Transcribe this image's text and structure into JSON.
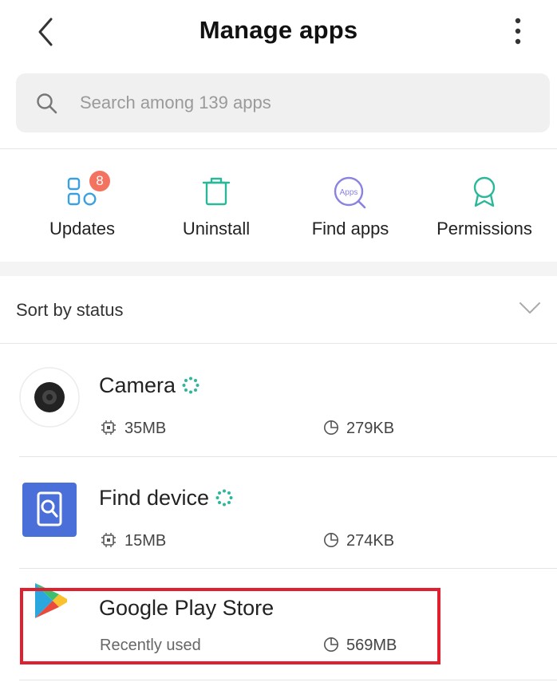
{
  "header": {
    "title": "Manage apps",
    "back_icon": "chevron-left-icon",
    "more_icon": "more-vertical-icon"
  },
  "search": {
    "placeholder": "Search among 139 apps",
    "value": ""
  },
  "quick_actions": [
    {
      "label": "Updates",
      "icon": "updates-grid-icon",
      "badge": "8"
    },
    {
      "label": "Uninstall",
      "icon": "trash-icon"
    },
    {
      "label": "Find apps",
      "icon": "find-apps-icon",
      "icon_text": "Apps"
    },
    {
      "label": "Permissions",
      "icon": "ribbon-icon"
    }
  ],
  "sort": {
    "label": "Sort by status",
    "icon": "chevron-down-icon"
  },
  "apps": [
    {
      "name": "Camera",
      "storage": "35MB",
      "cache": "279KB",
      "status": "loading"
    },
    {
      "name": "Find device",
      "storage": "15MB",
      "cache": "274KB",
      "status": "loading"
    },
    {
      "name": "Google Play Store",
      "subtitle": "Recently used",
      "cache": "569MB"
    }
  ],
  "colors": {
    "accent_teal": "#2bb89a",
    "badge": "#f47360",
    "highlight": "#e0202e",
    "icon_blue": "#3aa0e0",
    "icon_purple": "#8a83e0"
  }
}
